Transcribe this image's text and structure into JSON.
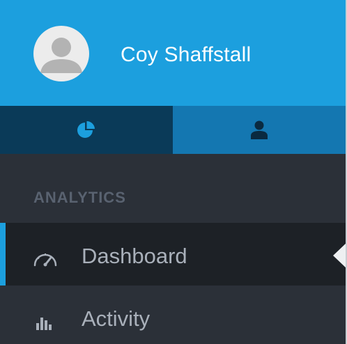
{
  "profile": {
    "name": "Coy Shaffstall",
    "avatar_icon": "user-silhouette-icon"
  },
  "tabs": [
    {
      "icon": "pie-chart-icon",
      "active": true
    },
    {
      "icon": "user-icon",
      "active": false
    }
  ],
  "nav": {
    "section_heading": "ANALYTICS",
    "items": [
      {
        "label": "Dashboard",
        "icon": "gauge-icon",
        "active": true
      },
      {
        "label": "Activity",
        "icon": "bar-chart-icon",
        "active": false
      }
    ]
  },
  "colors": {
    "brand_blue": "#1c9fde",
    "tab_dark": "#0a3a58",
    "tab_mid": "#1477b1",
    "sidebar_bg": "#2b3038",
    "active_item_bg": "#1d2126"
  }
}
